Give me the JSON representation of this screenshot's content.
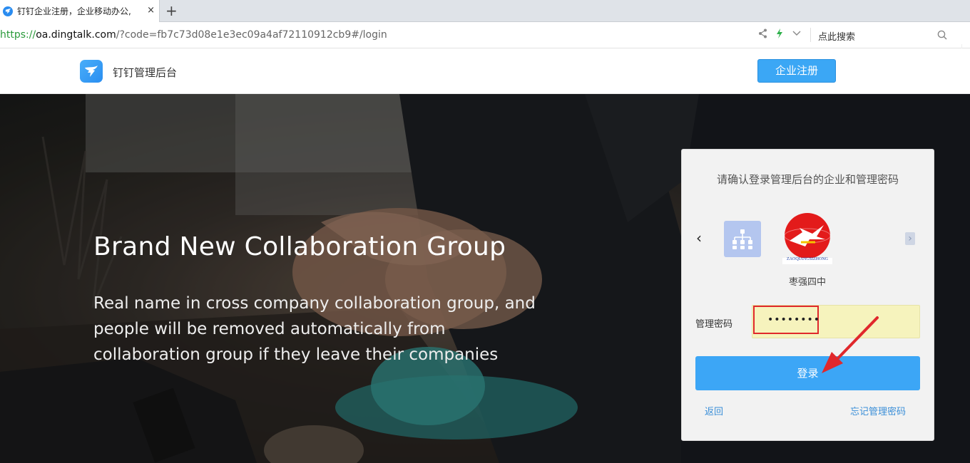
{
  "browser": {
    "tab_title": "钉钉企业注册，企业移动办公,",
    "tab_close": "×",
    "new_tab": "+",
    "url_scheme": "https://",
    "url_host": "oa.dingtalk.com",
    "url_path": "/?code=fb7c73d08e1e3ec09a4af72110912cb9#/login",
    "search_placeholder": "点此搜索"
  },
  "header": {
    "brand": "钉钉管理后台",
    "register_label": "企业注册"
  },
  "hero": {
    "title": "Brand New Collaboration Group",
    "subtitle": "Real name in cross company collaboration group, and people will be removed automatically from collaboration group if they leave their companies"
  },
  "login": {
    "prompt": "请确认登录管理后台的企业和管理密码",
    "prev_arrow": "‹",
    "next_arrow": "›",
    "school_name": "枣强四中",
    "school_logo_text": "ZAOQIANGSIZHONG",
    "password_label": "管理密码",
    "password_value": "••••••••",
    "submit_label": "登录",
    "back_label": "返回",
    "forgot_label": "忘记管理密码"
  },
  "colors": {
    "accent": "#3ca6f6",
    "annotation": "#e0282c",
    "autofill": "#f6f3bd"
  },
  "icons": [
    "dingtalk-favicon-icon",
    "share-icon",
    "bolt-icon",
    "chevron-down-icon",
    "search-icon",
    "dingtalk-logo-icon",
    "org-tree-icon",
    "chevron-left-icon",
    "chevron-right-icon"
  ]
}
